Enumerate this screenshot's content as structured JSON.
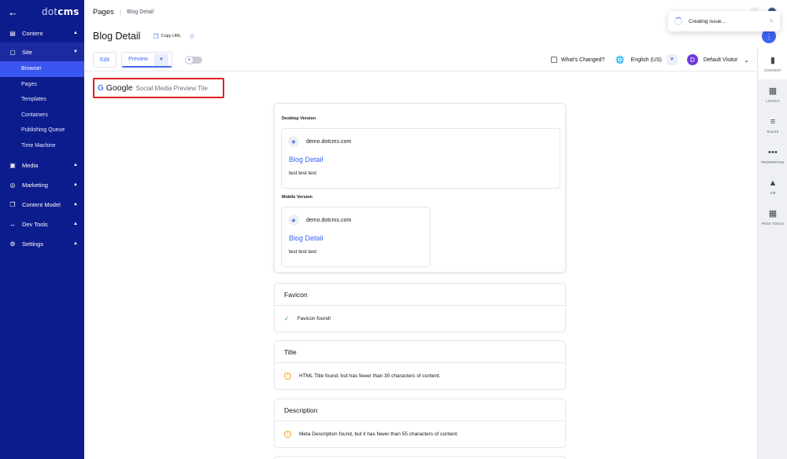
{
  "sidebar": {
    "logo_prefix": "dot",
    "logo_suffix": "cms",
    "groups": [
      {
        "label": "Content"
      },
      {
        "label": "Site"
      },
      {
        "label": "Media"
      },
      {
        "label": "Marketing"
      },
      {
        "label": "Content Model"
      },
      {
        "label": "Dev Tools"
      },
      {
        "label": "Settings"
      }
    ],
    "site_items": [
      {
        "label": "Browser"
      },
      {
        "label": "Pages"
      },
      {
        "label": "Templates"
      },
      {
        "label": "Containers"
      },
      {
        "label": "Publishing Queue"
      },
      {
        "label": "Time Machine"
      }
    ]
  },
  "header": {
    "breadcrumb_root": "Pages",
    "breadcrumb_current": "Blog Detail",
    "page_title": "Blog Detail",
    "copy_url_label": "Copy URL"
  },
  "toolbar": {
    "edit_label": "Edit",
    "preview_label": "Preview",
    "whats_changed_label": "What's Changed?",
    "language": "English (US)",
    "visitor_initial": "D",
    "visitor_label": "Default Visitor"
  },
  "toast": {
    "message": "Creating issue..."
  },
  "right_tools": [
    {
      "label": "CONTENT",
      "icon": "file-icon"
    },
    {
      "label": "LAYOUT",
      "icon": "layout-icon"
    },
    {
      "label": "RULES",
      "icon": "sliders-icon"
    },
    {
      "label": "PROPERTIES",
      "icon": "more-horizontal-icon"
    },
    {
      "label": "A/B",
      "icon": "flask-icon"
    },
    {
      "label": "PAGE TOOLS",
      "icon": "grid-icon"
    }
  ],
  "seo": {
    "engine_label": "Google",
    "heading": "Social Media Preview Tile",
    "desktop_label": "Desktop Version",
    "mobile_label": "Mobile Version",
    "desktop": {
      "site": "demo.dotcms.com",
      "title": "Blog Detail",
      "description": "test test test"
    },
    "mobile": {
      "site": "demo.dotcms.com",
      "title": "Blog Detail",
      "description": "test test test"
    },
    "checks": [
      {
        "title": "Favicon",
        "message": "Favicon found!",
        "status": "success"
      },
      {
        "title": "Title",
        "message": "HTML Title found, but has fewer than 30 characters of content.",
        "status": "warning"
      },
      {
        "title": "Description",
        "message": "Meta Description found, but it has fewer than 55 characters of content.",
        "status": "warning"
      }
    ]
  },
  "colors": {
    "sidebar_bg": "#0d1c8c",
    "sidebar_active": "#3b55f0",
    "accent": "#426bf0",
    "highlight_border": "#e11d24",
    "success": "#22a06b",
    "warning": "#f59e0b"
  }
}
